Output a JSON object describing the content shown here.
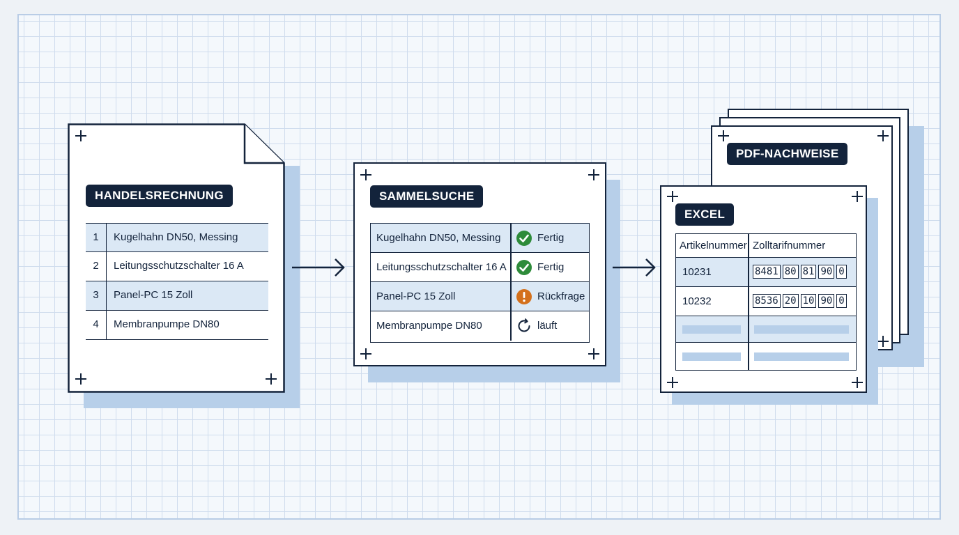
{
  "invoice": {
    "tag": "HANDELSRECHNUNG",
    "rows": [
      {
        "num": "1",
        "text": "Kugelhahn DN50, Messing"
      },
      {
        "num": "2",
        "text": "Leitungsschutzschalter 16 A"
      },
      {
        "num": "3",
        "text": "Panel-PC 15 Zoll"
      },
      {
        "num": "4",
        "text": "Membranpumpe DN80"
      }
    ]
  },
  "search": {
    "tag": "SAMMELSUCHE",
    "rows": [
      {
        "name": "Kugelhahn DN50, Messing",
        "status": "Fertig",
        "icon": "check-circle-icon",
        "color": "#2e8b3a"
      },
      {
        "name": "Leitungsschutzschalter 16 A",
        "status": "Fertig",
        "icon": "check-circle-icon",
        "color": "#2e8b3a"
      },
      {
        "name": "Panel-PC 15 Zoll",
        "status": "Rückfrage",
        "icon": "warning-circle-icon",
        "color": "#d4701b"
      },
      {
        "name": "Membranpumpe DN80",
        "status": "läuft",
        "icon": "refresh-icon",
        "color": "#13233b"
      }
    ]
  },
  "pdf": {
    "tag": "PDF-NACHWEISE"
  },
  "excel": {
    "tag": "EXCEL",
    "headers": [
      "Artikelnummer",
      "Zolltarifnummer"
    ],
    "rows": [
      {
        "article": "10231",
        "code": [
          "8481",
          "80",
          "81",
          "90",
          "0"
        ]
      },
      {
        "article": "10232",
        "code": [
          "8536",
          "20",
          "10",
          "90",
          "0"
        ]
      }
    ]
  },
  "colors": {
    "ink": "#13233b",
    "accent": "#b7cfe9",
    "row_highlight": "#dbe8f5"
  }
}
